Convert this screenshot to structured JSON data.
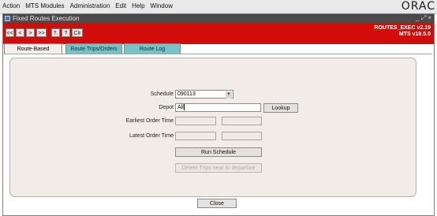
{
  "menu": [
    "Action",
    "MTS Modules",
    "Administration",
    "Edit",
    "Help",
    "Window"
  ],
  "brand": "ORAC",
  "window": {
    "title": "Fixed Routes Execution",
    "controls": "_ ⤢ ×"
  },
  "toolbar": {
    "buttons": [
      "<<",
      "<",
      ">",
      ">>",
      "?.",
      "?",
      "Clr"
    ],
    "version_line1": "ROUTES_EXEC v2.19",
    "version_line2": "MTS v18.5.0"
  },
  "tabs": [
    "Route-Based Scheduling",
    "Route Trips/Orders",
    "Route Log"
  ],
  "form": {
    "schedule_label": "Schedule",
    "schedule_value": "090113",
    "depot_label": "Depot",
    "depot_value": "All",
    "lookup_button": "Lookup",
    "earliest_label": "Earliest Order Time",
    "latest_label": "Latest Order Time",
    "run_button": "Run Schedule",
    "delete_button": "Delete Trips near to departure"
  },
  "close_button": "Close"
}
